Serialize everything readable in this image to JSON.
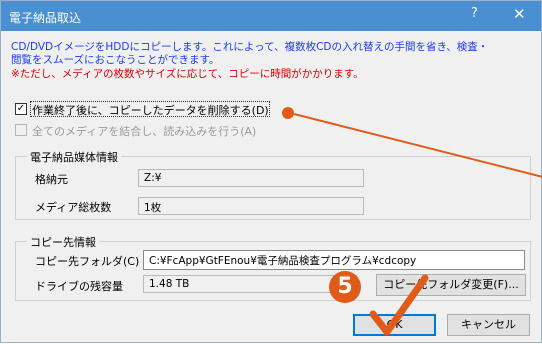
{
  "window": {
    "title": "電子納品取込",
    "help": "?",
    "close": "✕"
  },
  "description": {
    "line1": "CD/DVDイメージをHDDにコピーします。これによって、複数枚CDの入れ替えの手間を省き、検査・",
    "line2": "閲覧をスムーズにおこなうことができます。",
    "warning": "※ただし、メディアの枚数やサイズに応じて、コピーに時間がかかります。"
  },
  "options": {
    "delete_after": {
      "label": "作業終了後に、コピーしたデータを削除する(D)",
      "checked": "✓"
    },
    "merge_media": {
      "label": "全てのメディアを結合し、読み込みを行う(A)",
      "checked": ""
    }
  },
  "media_info": {
    "group_title": "電子納品媒体情報",
    "source_label": "格納元",
    "source_value": "Z:¥",
    "count_label": "メディア総枚数",
    "count_value": "1枚"
  },
  "copy_info": {
    "group_title": "コピー先情報",
    "folder_label": "コピー先フォルダ(C)",
    "folder_value": "C:¥FcApp¥GtFEnou¥電子納品検査プログラム¥cdcopy",
    "free_label": "ドライブの残容量",
    "free_value": "1.48 TB",
    "change_button": "コピー先フォルダ変更(F)..."
  },
  "buttons": {
    "ok": "OK",
    "cancel": "キャンセル"
  },
  "annotation": {
    "step": "5"
  },
  "colors": {
    "title_bar": "#4a8fd1",
    "desc_text": "#1a3cff",
    "warning_text": "#e00000",
    "accent": "#e05a1a"
  }
}
